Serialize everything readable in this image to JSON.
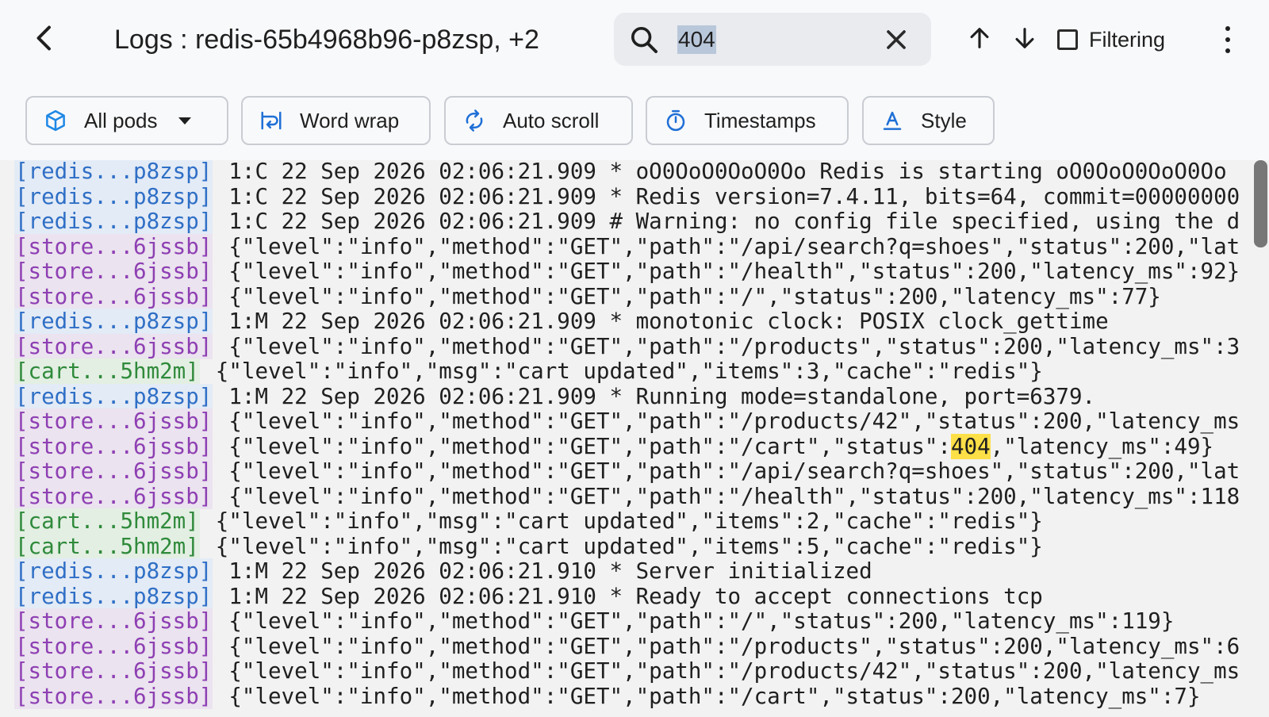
{
  "header": {
    "title": "Logs : redis-65b4968b96-p8zsp, +2",
    "back_icon": "arrow-back-icon",
    "search": {
      "value": "404",
      "placeholder": ""
    },
    "filter_label": "Filtering",
    "filter_checked": false
  },
  "toolbar": {
    "pods_label": "All pods",
    "wrap_label": "Word wrap",
    "scroll_label": "Auto scroll",
    "timestamps_label": "Timestamps",
    "style_label": "Style"
  },
  "colors": {
    "redis": {
      "fg": "#2f6fc6",
      "bg": "#e3ebf6"
    },
    "store": {
      "fg": "#8e3fb3",
      "bg": "#ebe3ef"
    },
    "cart": {
      "fg": "#2f8a3b",
      "bg": "#e3efe3"
    },
    "highlight": "#fde047"
  },
  "logs": [
    {
      "pod": "[redis...p8zsp]",
      "kind": "redis",
      "text": "1:C 22 Sep 2026 02:06:21.909 * oO0OoO0OoO0Oo Redis is starting oO0OoO0OoO0Oo"
    },
    {
      "pod": "[redis...p8zsp]",
      "kind": "redis",
      "text": "1:C 22 Sep 2026 02:06:21.909 * Redis version=7.4.11, bits=64, commit=00000000"
    },
    {
      "pod": "[redis...p8zsp]",
      "kind": "redis",
      "text": "1:C 22 Sep 2026 02:06:21.909 # Warning: no config file specified, using the d"
    },
    {
      "pod": "[store...6jssb]",
      "kind": "store",
      "text": "{\"level\":\"info\",\"method\":\"GET\",\"path\":\"/api/search?q=shoes\",\"status\":200,\"lat"
    },
    {
      "pod": "[store...6jssb]",
      "kind": "store",
      "text": "{\"level\":\"info\",\"method\":\"GET\",\"path\":\"/health\",\"status\":200,\"latency_ms\":92}"
    },
    {
      "pod": "[store...6jssb]",
      "kind": "store",
      "text": "{\"level\":\"info\",\"method\":\"GET\",\"path\":\"/\",\"status\":200,\"latency_ms\":77}"
    },
    {
      "pod": "[redis...p8zsp]",
      "kind": "redis",
      "text": "1:M 22 Sep 2026 02:06:21.909 * monotonic clock: POSIX clock_gettime"
    },
    {
      "pod": "[store...6jssb]",
      "kind": "store",
      "text": "{\"level\":\"info\",\"method\":\"GET\",\"path\":\"/products\",\"status\":200,\"latency_ms\":3"
    },
    {
      "pod": "[cart...5hm2m]",
      "kind": "cart",
      "text": "{\"level\":\"info\",\"msg\":\"cart updated\",\"items\":3,\"cache\":\"redis\"}"
    },
    {
      "pod": "[redis...p8zsp]",
      "kind": "redis",
      "text": "1:M 22 Sep 2026 02:06:21.909 * Running mode=standalone, port=6379."
    },
    {
      "pod": "[store...6jssb]",
      "kind": "store",
      "text": "{\"level\":\"info\",\"method\":\"GET\",\"path\":\"/products/42\",\"status\":200,\"latency_ms"
    },
    {
      "pod": "[store...6jssb]",
      "kind": "store",
      "text": "{\"level\":\"info\",\"method\":\"GET\",\"path\":\"/cart\",\"status\":404,\"latency_ms\":49}"
    },
    {
      "pod": "[store...6jssb]",
      "kind": "store",
      "text": "{\"level\":\"info\",\"method\":\"GET\",\"path\":\"/api/search?q=shoes\",\"status\":200,\"lat"
    },
    {
      "pod": "[store...6jssb]",
      "kind": "store",
      "text": "{\"level\":\"info\",\"method\":\"GET\",\"path\":\"/health\",\"status\":200,\"latency_ms\":118"
    },
    {
      "pod": "[cart...5hm2m]",
      "kind": "cart",
      "text": "{\"level\":\"info\",\"msg\":\"cart updated\",\"items\":2,\"cache\":\"redis\"}"
    },
    {
      "pod": "[cart...5hm2m]",
      "kind": "cart",
      "text": "{\"level\":\"info\",\"msg\":\"cart updated\",\"items\":5,\"cache\":\"redis\"}"
    },
    {
      "pod": "[redis...p8zsp]",
      "kind": "redis",
      "text": "1:M 22 Sep 2026 02:06:21.910 * Server initialized"
    },
    {
      "pod": "[redis...p8zsp]",
      "kind": "redis",
      "text": "1:M 22 Sep 2026 02:06:21.910 * Ready to accept connections tcp"
    },
    {
      "pod": "[store...6jssb]",
      "kind": "store",
      "text": "{\"level\":\"info\",\"method\":\"GET\",\"path\":\"/\",\"status\":200,\"latency_ms\":119}"
    },
    {
      "pod": "[store...6jssb]",
      "kind": "store",
      "text": "{\"level\":\"info\",\"method\":\"GET\",\"path\":\"/products\",\"status\":200,\"latency_ms\":6"
    },
    {
      "pod": "[store...6jssb]",
      "kind": "store",
      "text": "{\"level\":\"info\",\"method\":\"GET\",\"path\":\"/products/42\",\"status\":200,\"latency_ms"
    },
    {
      "pod": "[store...6jssb]",
      "kind": "store",
      "text": "{\"level\":\"info\",\"method\":\"GET\",\"path\":\"/cart\",\"status\":200,\"latency_ms\":7}"
    }
  ]
}
